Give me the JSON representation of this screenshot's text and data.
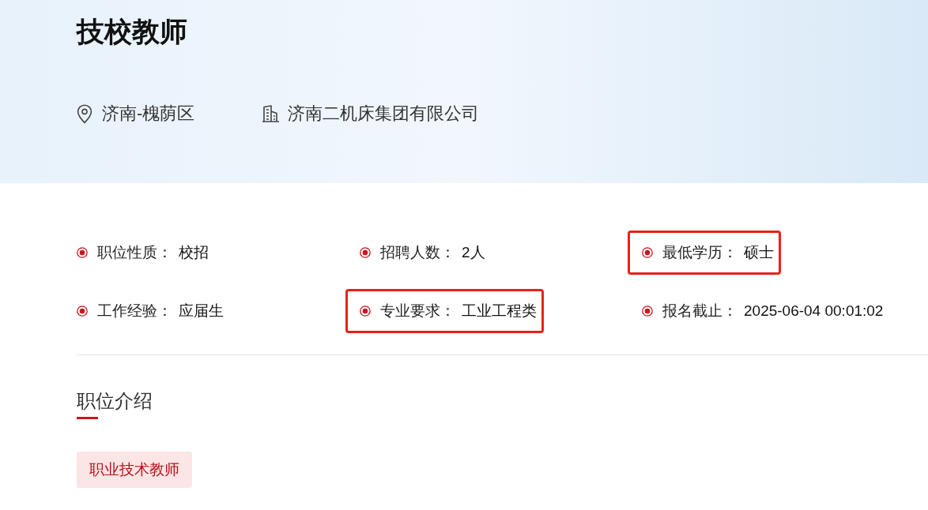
{
  "header": {
    "title": "技校教师",
    "location": "济南-槐荫区",
    "company": "济南二机床集团有限公司"
  },
  "info": [
    {
      "label": "职位性质：",
      "value": "校招",
      "highlighted": false
    },
    {
      "label": "招聘人数：",
      "value": "2人",
      "highlighted": false
    },
    {
      "label": "最低学历：",
      "value": "硕士",
      "highlighted": true
    },
    {
      "label": "工作经验：",
      "value": "应届生",
      "highlighted": false
    },
    {
      "label": "专业要求：",
      "value": "工业工程类",
      "highlighted": true
    },
    {
      "label": "报名截止：",
      "value": "2025-06-04 00:01:02",
      "highlighted": false
    }
  ],
  "section": {
    "title": "职位介绍",
    "tags": [
      "职业技术教师"
    ]
  }
}
